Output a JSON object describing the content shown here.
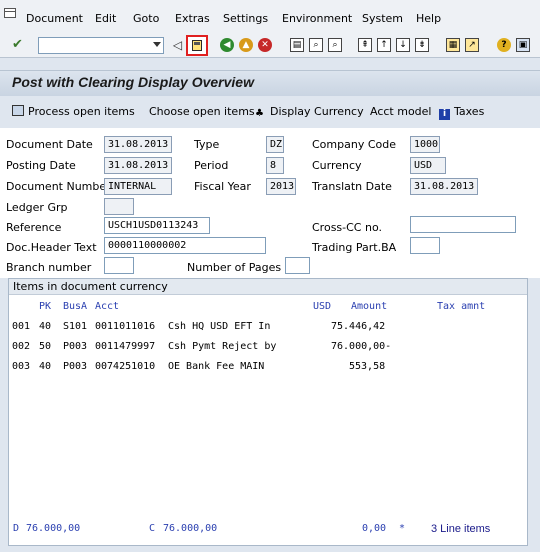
{
  "menu": [
    "Document",
    "Edit",
    "Goto",
    "Extras",
    "Settings",
    "Environment",
    "System",
    "Help"
  ],
  "toolbar": {
    "command_value": "",
    "icons": [
      "check-icon",
      "back-triangle-icon",
      "save-icon",
      "back-icon",
      "exit-icon",
      "cancel-icon",
      "print-icon",
      "find-icon",
      "find-next-icon",
      "first-page-icon",
      "prev-page-icon",
      "next-page-icon",
      "last-page-icon",
      "new-session-icon",
      "shortcut-icon",
      "help-icon",
      "customize-icon"
    ]
  },
  "title": "Post with Clearing Display Overview",
  "app_toolbar": {
    "process_open_items": "Process open items",
    "choose_open_items": "Choose open items",
    "display_currency": "Display Currency",
    "acct_model": "Acct model",
    "taxes": "Taxes"
  },
  "form": {
    "document_date_label": "Document Date",
    "document_date": "31.08.2013",
    "type_label": "Type",
    "type": "DZ",
    "company_code_label": "Company Code",
    "company_code": "1000",
    "posting_date_label": "Posting Date",
    "posting_date": "31.08.2013",
    "period_label": "Period",
    "period": "8",
    "currency_label": "Currency",
    "currency": "USD",
    "document_number_label": "Document Number",
    "document_number": "INTERNAL",
    "fiscal_year_label": "Fiscal Year",
    "fiscal_year": "2013",
    "translatn_date_label": "Translatn Date",
    "translatn_date": "31.08.2013",
    "ledger_grp_label": "Ledger Grp",
    "ledger_grp": "",
    "reference_label": "Reference",
    "reference": "USCH1USD0113243",
    "cross_cc_label": "Cross-CC no.",
    "cross_cc": "",
    "doc_header_text_label": "Doc.Header Text",
    "doc_header_text": "0000110000002",
    "trading_part_label": "Trading Part.BA",
    "trading_part": "",
    "branch_number_label": "Branch number",
    "branch_number": "",
    "number_of_pages_label": "Number of Pages",
    "number_of_pages": ""
  },
  "items": {
    "header": "Items in document currency",
    "columns": {
      "pk": "PK",
      "busa": "BusA",
      "acct": "Acct",
      "usd": "USD",
      "amount": "Amount",
      "tax_amnt": "Tax amnt"
    },
    "rows": [
      {
        "line": "001",
        "pk": "40",
        "busa": "S101",
        "acct": "0011011016",
        "text": "Csh HQ USD EFT In",
        "amount": "75.446,42"
      },
      {
        "line": "002",
        "pk": "50",
        "busa": "P003",
        "acct": "0011479997",
        "text": "Csh Pymt Reject by",
        "amount": "76.000,00-"
      },
      {
        "line": "003",
        "pk": "40",
        "busa": "P003",
        "acct": "0074251010",
        "text": "OE Bank Fee MAIN",
        "amount": "553,58"
      }
    ],
    "footer": {
      "d_label": "D",
      "d_value": "76.000,00",
      "c_label": "C",
      "c_value": "76.000,00",
      "balance": "0,00",
      "star": "*",
      "line_items": "3 Line items"
    }
  }
}
